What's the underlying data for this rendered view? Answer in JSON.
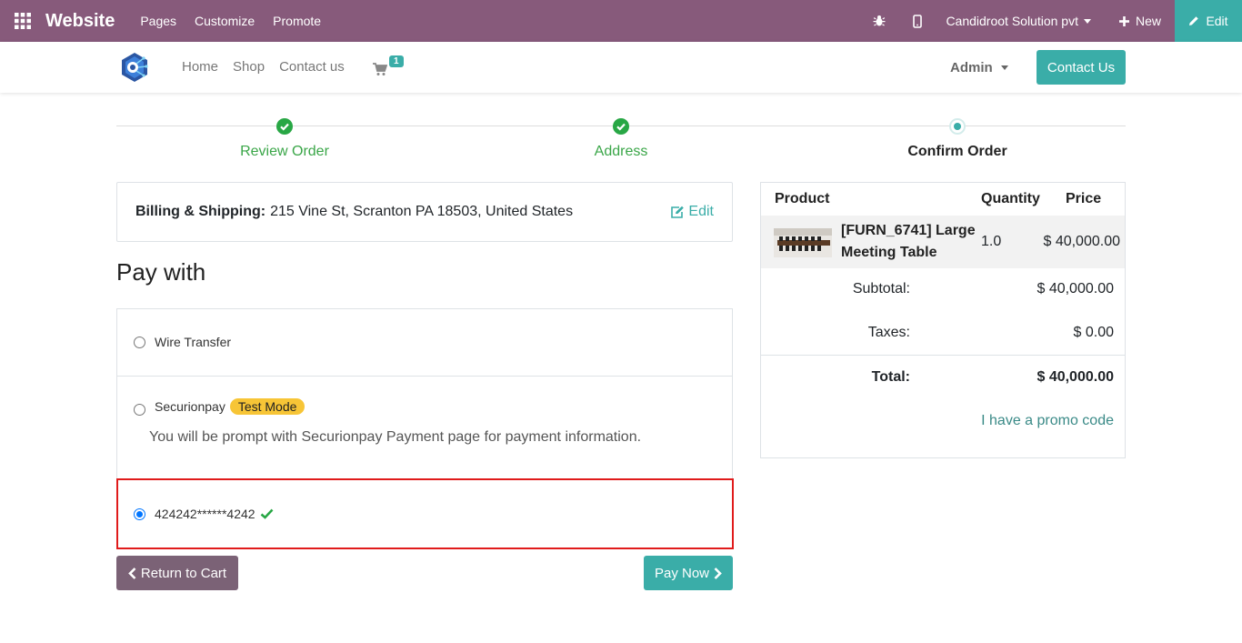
{
  "topbar": {
    "app_name": "Website",
    "menu": [
      "Pages",
      "Customize",
      "Promote"
    ],
    "company": "Candidroot Solution pvt",
    "new_label": "New",
    "edit_label": "Edit",
    "color": "#875a7b",
    "edit_color": "#3aada8"
  },
  "header": {
    "nav": [
      "Home",
      "Shop",
      "Contact us"
    ],
    "cart_count": "1",
    "user": "Admin",
    "contact_button": "Contact Us"
  },
  "progress": {
    "steps": [
      "Review Order",
      "Address",
      "Confirm Order"
    ]
  },
  "billing": {
    "label": "Billing & Shipping:",
    "address": "215 Vine St, Scranton PA 18503, United States",
    "edit_label": "Edit"
  },
  "payment": {
    "title": "Pay with",
    "options": [
      {
        "label": "Wire Transfer",
        "selected": false
      },
      {
        "label": "Securionpay",
        "badge": "Test Mode",
        "description": "You will be prompt with Securionpay Payment page for payment information.",
        "selected": false
      },
      {
        "label": "424242******4242",
        "selected": true
      }
    ],
    "return_button": "Return to Cart",
    "pay_button": "Pay Now"
  },
  "summary": {
    "headers": [
      "Product",
      "Quantity",
      "Price"
    ],
    "product_name": "[FURN_6741] Large Meeting Table",
    "quantity": "1.0",
    "price": "$ 40,000.00",
    "subtotal_label": "Subtotal:",
    "subtotal": "$ 40,000.00",
    "taxes_label": "Taxes:",
    "taxes": "$ 0.00",
    "total_label": "Total:",
    "total": "$ 40,000.00",
    "promo": "I have a promo code"
  }
}
